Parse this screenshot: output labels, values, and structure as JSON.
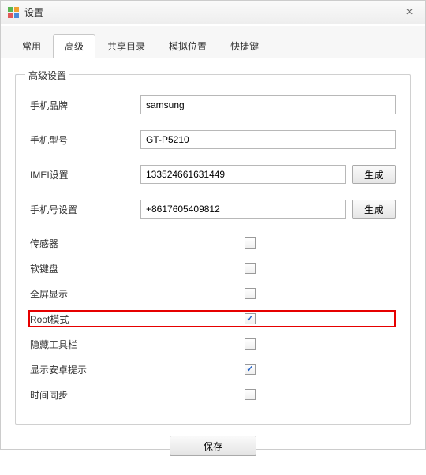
{
  "window": {
    "title": "设置"
  },
  "tabs": {
    "items": [
      "常用",
      "高级",
      "共享目录",
      "模拟位置",
      "快捷键"
    ],
    "active_index": 1
  },
  "fieldset": {
    "legend": "高级设置"
  },
  "fields": {
    "brand": {
      "label": "手机品牌",
      "value": "samsung"
    },
    "model": {
      "label": "手机型号",
      "value": "GT-P5210"
    },
    "imei": {
      "label": "IMEI设置",
      "value": "133524661631449",
      "button": "生成"
    },
    "phone": {
      "label": "手机号设置",
      "value": "+8617605409812",
      "button": "生成"
    }
  },
  "checks": [
    {
      "label": "传感器",
      "checked": false,
      "highlight": false
    },
    {
      "label": "软键盘",
      "checked": false,
      "highlight": false
    },
    {
      "label": "全屏显示",
      "checked": false,
      "highlight": false
    },
    {
      "label": "Root模式",
      "checked": true,
      "highlight": true
    },
    {
      "label": "隐藏工具栏",
      "checked": false,
      "highlight": false
    },
    {
      "label": "显示安卓提示",
      "checked": true,
      "highlight": false
    },
    {
      "label": "时间同步",
      "checked": false,
      "highlight": false
    }
  ],
  "footer": {
    "save": "保存"
  }
}
